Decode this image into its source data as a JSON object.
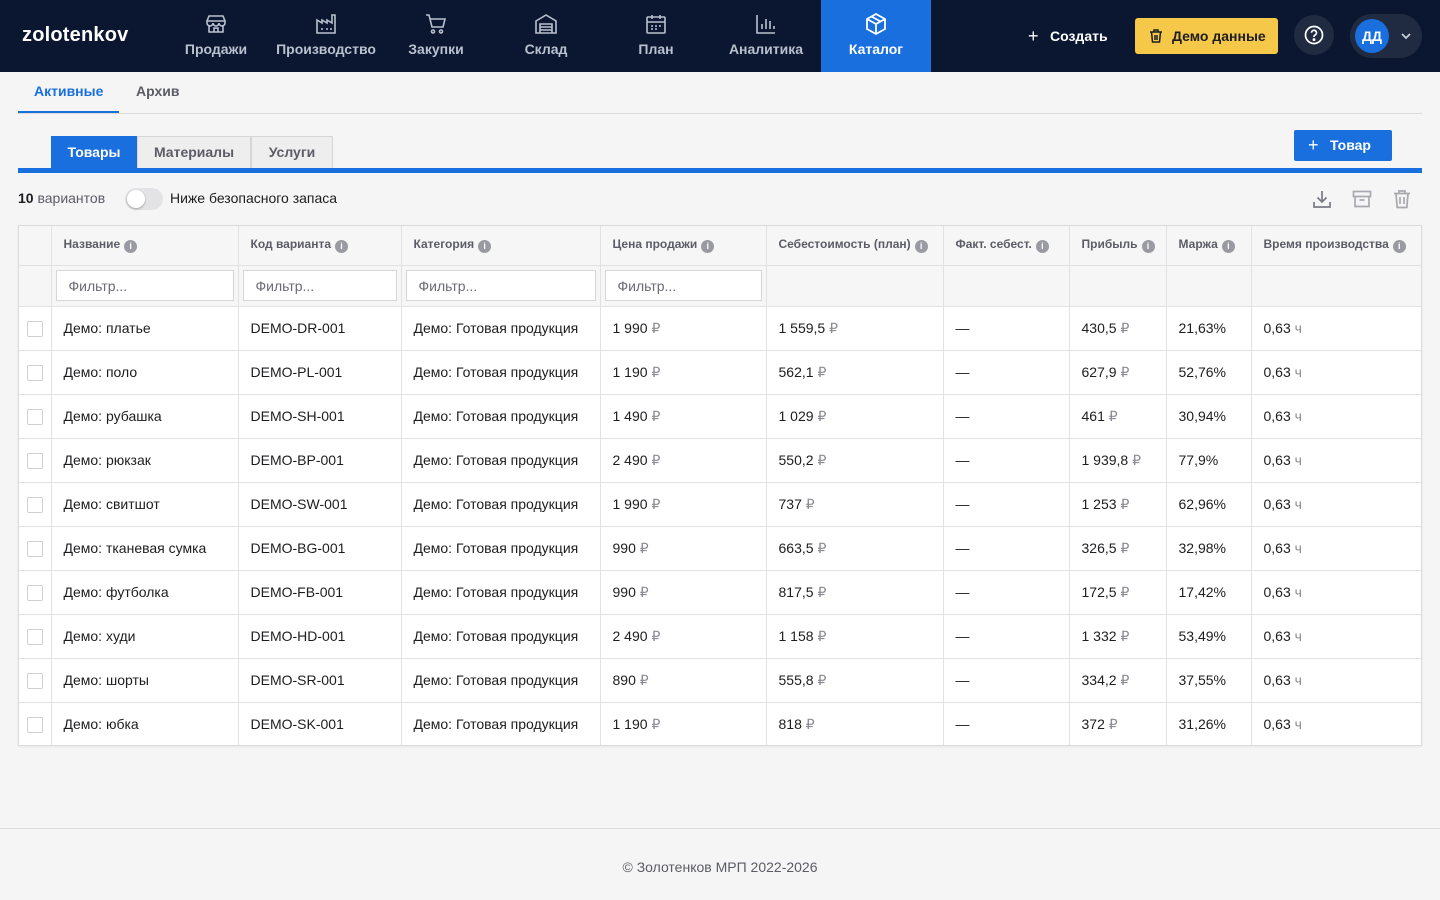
{
  "app": {
    "logo": "zolotenkov"
  },
  "nav": {
    "items": [
      {
        "label": "Продажи",
        "icon": "store-icon"
      },
      {
        "label": "Производство",
        "icon": "factory-icon"
      },
      {
        "label": "Закупки",
        "icon": "cart-icon"
      },
      {
        "label": "Склад",
        "icon": "warehouse-icon"
      },
      {
        "label": "План",
        "icon": "calendar-icon"
      },
      {
        "label": "Аналитика",
        "icon": "bar-chart-icon"
      },
      {
        "label": "Каталог",
        "icon": "box-icon",
        "active": true
      }
    ],
    "create_label": "Создать",
    "demo_label": "Демо данные",
    "avatar_initials": "ДД"
  },
  "subtabs": [
    "Активные",
    "Архив"
  ],
  "type_tabs": [
    "Товары",
    "Материалы",
    "Услуги"
  ],
  "add_button_label": "Товар",
  "toolbar": {
    "count": "10",
    "count_suffix": "вариантов",
    "toggle_label": "Ниже безопасного запаса"
  },
  "table": {
    "columns": [
      "Название",
      "Код варианта",
      "Категория",
      "Цена продажи",
      "Себестоимость (план)",
      "Факт. себест.",
      "Прибыль",
      "Маржа",
      "Время производства"
    ],
    "filter_placeholder": "Фильтр...",
    "currency": "₽",
    "hours_unit": "ч",
    "rows": [
      {
        "name": "Демо: платье",
        "code": "DEMO-DR-001",
        "category": "Демо: Готовая продукция",
        "price": "1 990",
        "cost": "1 559,5",
        "fact": "—",
        "profit": "430,5",
        "margin": "21,63%",
        "time": "0,63"
      },
      {
        "name": "Демо: поло",
        "code": "DEMO-PL-001",
        "category": "Демо: Готовая продукция",
        "price": "1 190",
        "cost": "562,1",
        "fact": "—",
        "profit": "627,9",
        "margin": "52,76%",
        "time": "0,63"
      },
      {
        "name": "Демо: рубашка",
        "code": "DEMO-SH-001",
        "category": "Демо: Готовая продукция",
        "price": "1 490",
        "cost": "1 029",
        "fact": "—",
        "profit": "461",
        "margin": "30,94%",
        "time": "0,63"
      },
      {
        "name": "Демо: рюкзак",
        "code": "DEMO-BP-001",
        "category": "Демо: Готовая продукция",
        "price": "2 490",
        "cost": "550,2",
        "fact": "—",
        "profit": "1 939,8",
        "margin": "77,9%",
        "time": "0,63"
      },
      {
        "name": "Демо: свитшот",
        "code": "DEMO-SW-001",
        "category": "Демо: Готовая продукция",
        "price": "1 990",
        "cost": "737",
        "fact": "—",
        "profit": "1 253",
        "margin": "62,96%",
        "time": "0,63"
      },
      {
        "name": "Демо: тканевая сумка",
        "code": "DEMO-BG-001",
        "category": "Демо: Готовая продукция",
        "price": "990",
        "cost": "663,5",
        "fact": "—",
        "profit": "326,5",
        "margin": "32,98%",
        "time": "0,63"
      },
      {
        "name": "Демо: футболка",
        "code": "DEMO-FB-001",
        "category": "Демо: Готовая продукция",
        "price": "990",
        "cost": "817,5",
        "fact": "—",
        "profit": "172,5",
        "margin": "17,42%",
        "time": "0,63"
      },
      {
        "name": "Демо: худи",
        "code": "DEMO-HD-001",
        "category": "Демо: Готовая продукция",
        "price": "2 490",
        "cost": "1 158",
        "fact": "—",
        "profit": "1 332",
        "margin": "53,49%",
        "time": "0,63"
      },
      {
        "name": "Демо: шорты",
        "code": "DEMO-SR-001",
        "category": "Демо: Готовая продукция",
        "price": "890",
        "cost": "555,8",
        "fact": "—",
        "profit": "334,2",
        "margin": "37,55%",
        "time": "0,63"
      },
      {
        "name": "Демо: юбка",
        "code": "DEMO-SK-001",
        "category": "Демо: Готовая продукция",
        "price": "1 190",
        "cost": "818",
        "fact": "—",
        "profit": "372",
        "margin": "31,26%",
        "time": "0,63"
      }
    ]
  },
  "footer": {
    "text": "© Золотенков МРП 2022-2026"
  },
  "colors": {
    "nav_bg": "#0b1730",
    "accent": "#1a6fdf",
    "demo_button": "#f5c84a"
  }
}
